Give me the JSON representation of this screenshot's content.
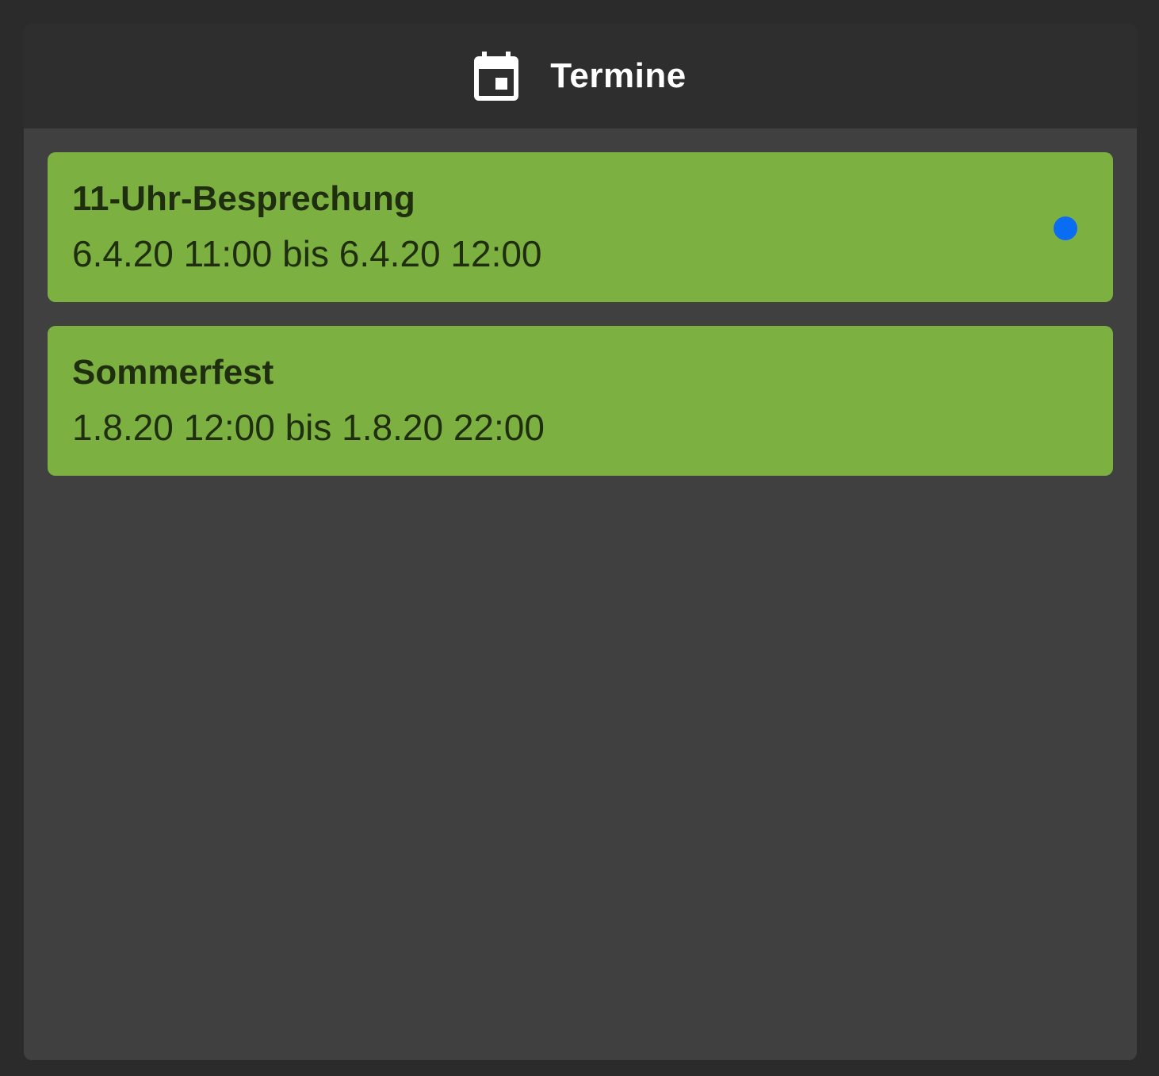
{
  "header": {
    "title": "Termine",
    "icon": "calendar-today-icon"
  },
  "colors": {
    "page_background": "#2b2b2b",
    "panel_background": "#404040",
    "header_background": "#2e2e2e",
    "event_card": "#7cb142",
    "event_text": "#1f2e0e",
    "status_dot": "#0a6cf2"
  },
  "events": [
    {
      "title": "11-Uhr-Besprechung",
      "time": "6.4.20 11:00 bis 6.4.20 12:00",
      "has_indicator": true
    },
    {
      "title": "Sommerfest",
      "time": "1.8.20 12:00 bis 1.8.20 22:00",
      "has_indicator": false
    }
  ]
}
